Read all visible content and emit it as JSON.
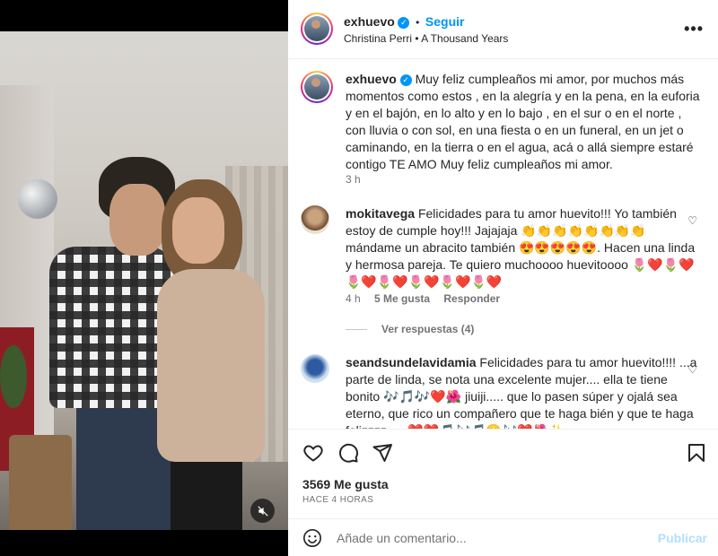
{
  "header": {
    "username": "exhuevo",
    "follow_label": "Seguir",
    "separator": "•",
    "audio": "Christina Perri • A Thousand Years",
    "more_icon": "more-horizontal-icon"
  },
  "caption": {
    "username": "exhuevo",
    "text": "Muy feliz cumpleaños mi amor, por muchos más momentos como estos , en la alegría y en la pena, en la euforia y en el bajón, en lo alto y en lo bajo , en el sur o en el norte , con lluvia o con sol, en una fiesta o en un funeral, en un jet o caminando, en la tierra o en el agua, acá o allá siempre estaré contigo TE AMO Muy feliz cumpleaños mi amor.",
    "time": "3 h"
  },
  "comments": [
    {
      "username": "mokitavega",
      "text": "Felicidades para tu amor huevito!!! Yo también estoy de cumple hoy!!! Jajajaja 👏👏👏👏👏👏👏👏 mándame un abracito también 😍😍😍😍😍. Hacen una linda y hermosa pareja. Te quiero muchoooo huevitoooo 🌷❤️🌷❤️🌷❤️🌷❤️🌷❤️🌷❤️🌷❤️",
      "time": "4 h",
      "likes": "5 Me gusta",
      "reply_label": "Responder",
      "view_replies": "Ver respuestas (4)"
    },
    {
      "username": "seandsundelavidamia",
      "text": "Felicidades para tu amor huevito!!!! ...a parte de linda, se nota una excelente mujer.... ella te tiene bonito 🎶🎵🎶❤️🌺 jiuiji..... que lo pasen súper y ojalá sea eterno, que rico un compañero que te haga bién y que te haga felizzzz..... ❤️❤️🎵🎶🎵😊🎶❤️🌺✨"
    }
  ],
  "actions": {
    "like_icon": "heart-icon",
    "comment_icon": "comment-icon",
    "share_icon": "send-icon",
    "save_icon": "bookmark-icon"
  },
  "likes_count": "3569 Me gusta",
  "posted_ago": "HACE 4 HORAS",
  "composer": {
    "placeholder": "Añade un comentario...",
    "publish_label": "Publicar"
  },
  "colors": {
    "accent": "#0095f6",
    "publish_disabled": "#b2dffc",
    "muted": "#737373"
  }
}
